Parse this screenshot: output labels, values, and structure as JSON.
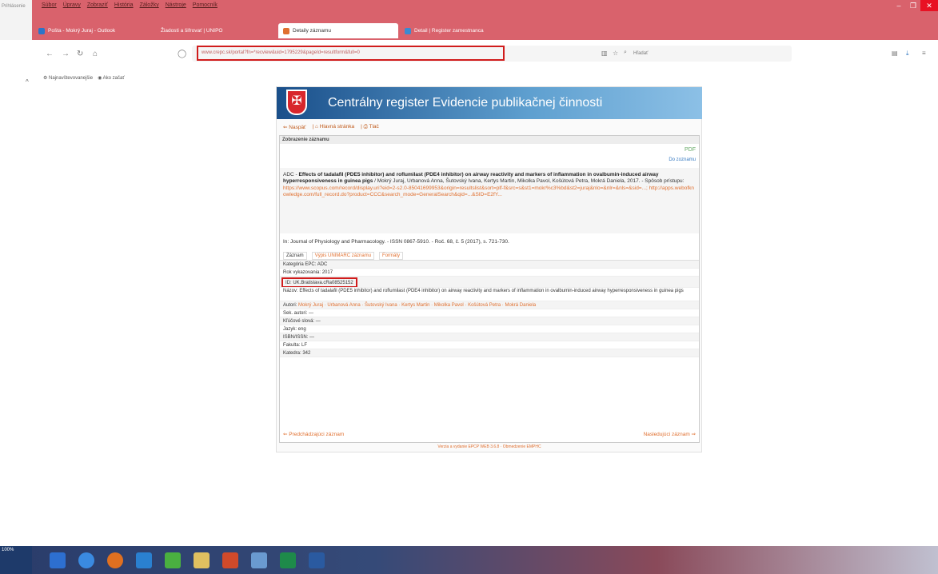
{
  "browser": {
    "menu": [
      "Súbor",
      "Úpravy",
      "Zobraziť",
      "História",
      "Záložky",
      "Nástroje",
      "Pomocník"
    ],
    "tabs": [
      {
        "label": "Pošta - Mokrý Juraj - Outlook"
      },
      {
        "label": "Žiadosti a šifrovať | UNIPO"
      },
      {
        "label": "Detaily záznamu"
      },
      {
        "label": "Detail | Register zamestnanca"
      }
    ],
    "url": "www.crepc.sk/portal?fn=*recview&uid=1795229&pageId=resultform&full=0",
    "search_placeholder": "Hľadať",
    "bookmarks": [
      "Najnavštevovanejšie",
      "Ako začať"
    ],
    "left_label": "Prihlásenie"
  },
  "page": {
    "banner_title": "Centrálny register Evidencie publikačnej činnosti",
    "crest": "✠",
    "nav": [
      "Naspäť",
      "Hlavná stránka",
      "Tlač"
    ],
    "section_title": "Zobrazenie záznamu",
    "pdf_label": "PDF",
    "zoz_label": "Do zoznamu",
    "record": {
      "prefix": "ADC - ",
      "title": "Effects of tadalafil (PDE5 inhibitor) and roflumilast (PDE4 inhibitor) on airway reactivity and markers of inflammation in ovalbumin-induced airway hyperresponsiveness in guinea pigs",
      "authors": " / Mokrý Juraj, Urbanová Anna, Šutovský Ivana, Kertys Martin, Mikolka Pavol, Košútová Petra, Mokrá Daniela, 2017. - Spôsob prístupu:",
      "links": "https://www.scopus.com/record/display.uri?eid=2-s2.0-85041699953&origin=resultslist&sort=plf-f&src=s&st1=mokr%c3%bd&st2=juraj&nlo=&nlr=&nls=&sid=...; http://apps.webofknowledge.com/full_record.do?product=CCC&search_mode=GeneralSearch&qid=...&SID=E2fY..."
    },
    "journal": "In: Journal of Physiology and Pharmacology. - ISSN 0867-5910. - Roč. 68, č. 5 (2017), s. 721-730.",
    "tabs": [
      "Záznam",
      "Výpis UNIMARC záznamu",
      "Formáty"
    ],
    "fields": {
      "category": "Kategória EPC: ADC",
      "year": "Rok vykazovania: 2017",
      "id": "ID: UK.Bratislava.cRa08525152",
      "name": "Názov: Effects of tadalafil (PDE5 inhibitor) and roflumilast (PDE4 inhibitor) on airway reactivity and markers of inflammation in ovalbumin-induced airway hyperresponsiveness in guinea pigs",
      "authors_label": "Autori:",
      "authors_list": "Mokrý Juraj · Urbanová Anna · Šutovský Ivana · Kertys Martin · Mikolka Pavol · Košútová Petra · Mokrá Daniela",
      "sek": "Sek. autori: —",
      "keywords": "Kľúčové slová: —",
      "lang": "Jazyk: eng",
      "isbn": "ISBN/ISSN: —",
      "faculty": "Fakulta: LF",
      "dept": "Katedra: 342"
    },
    "prev": "Predchádzajúci záznam",
    "next": "Nasledujúci záznam",
    "footer": "Verzia a vydanie EPCP WEB 3.6.8 · Obmedzenie EMPHC"
  },
  "taskbar": {
    "zoom": "100%"
  },
  "colors": {
    "titlebar": "#d9626c",
    "accent": "#e07030",
    "highlight": "#d01c1c"
  }
}
